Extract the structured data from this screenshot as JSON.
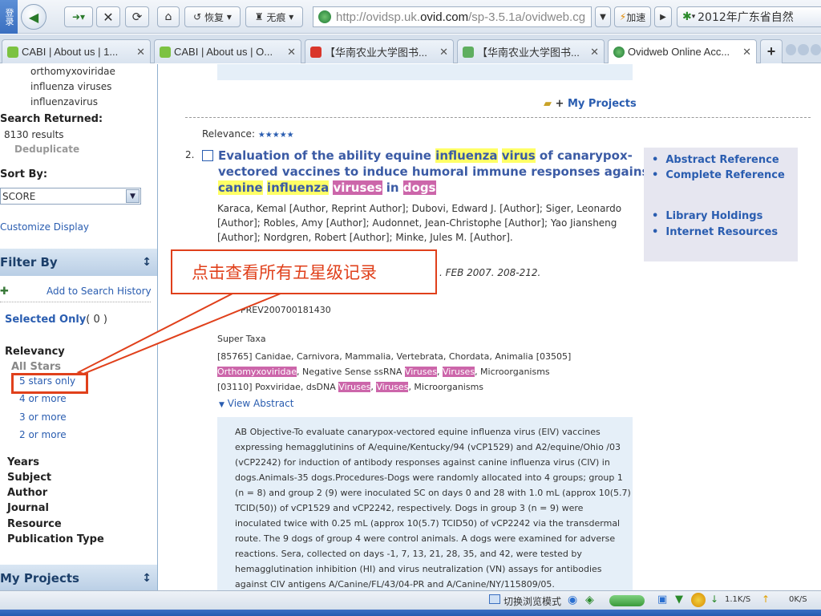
{
  "browser": {
    "side_label": "登录",
    "restore_label": "恢复",
    "notrace_label": "无痕",
    "url_prefix": "http://",
    "url_domain_pre": "ovidsp.uk.",
    "url_domain": "ovid.com",
    "url_path": "/sp-3.5.1a/ovidweb.cg",
    "accelerate_label": "加速",
    "search_text": "2012年广东省自然"
  },
  "tabs": [
    {
      "label": "CABI | About us | 1..."
    },
    {
      "label": "CABI | About us | O..."
    },
    {
      "label": "【华南农业大学图书..."
    },
    {
      "label": "【华南农业大学图书..."
    },
    {
      "label": "Ovidweb Online Acc..."
    }
  ],
  "sidebar": {
    "tree": [
      "orthomyxoviridae",
      "influenza viruses",
      "influenzavirus"
    ],
    "search_returned_label": "Search Returned:",
    "results": "8130 results",
    "deduplicate": "Deduplicate",
    "sort_by_label": "Sort By:",
    "sort_value": "SCORE",
    "customize": "Customize Display",
    "filter_by": "Filter By",
    "add_history": "Add to Search History",
    "selected_only": "Selected Only",
    "selected_count": "( 0 )",
    "relevancy_label": "Relevancy",
    "all_stars": "All Stars",
    "relevancy_options": [
      "5 stars only",
      "4 or more",
      "3 or more",
      "2 or more"
    ],
    "facets": [
      "Years",
      "Subject",
      "Author",
      "Journal",
      "Resource",
      "Publication Type"
    ],
    "my_projects": "My Projects"
  },
  "main": {
    "my_projects_link": "My Projects",
    "relevance_label": "Relevance:",
    "relevance_stars": "★★★★★",
    "record_number": "2.",
    "title": {
      "line1": [
        "Evaluation of the ability equine ",
        "influenza",
        " ",
        "virus",
        " of canarypox-"
      ],
      "line2": "vectored vaccines to induce humoral immune responses against",
      "line3": [
        "canine",
        " ",
        "influenza",
        " ",
        "viruses",
        " in ",
        "dogs"
      ]
    },
    "authors": [
      "Karaca, Kemal [Author, Reprint Author]; Dubovi, Edward J. [Author]; Siger, Leonardo",
      "[Author]; Robles, Amy [Author]; Audonnet, Jean-Christophe [Author]; Yao Jiansheng",
      "[Author]; Nordgren, Robert [Author]; Minke, Jules M. [Author]."
    ],
    "source_tail": ". FEB 2007. 208-212.",
    "accession": "PREV200700181430",
    "super_taxa_label": "Super Taxa",
    "taxa": {
      "line1": "[85765] Canidae, Carnivora, Mammalia, Vertebrata, Chordata, Animalia [03505]",
      "line2_hl1": "Orthomyxoviridae",
      "line2_mid": ", Negative Sense ssRNA ",
      "line2_hl2": "Viruses",
      "line2_sep": ", ",
      "line2_hl3": "Viruses",
      "line2_end": ", Microorganisms",
      "line3_pre": "[03110] Poxviridae, dsDNA ",
      "line3_hl1": "Viruses",
      "line3_sep": ", ",
      "line3_hl2": "Viruses",
      "line3_end": ", Microorganisms"
    },
    "view_abstract": "View Abstract",
    "abstract_lines": [
      "AB Objective-To evaluate canarypox-vectored equine influenza virus (EIV) vaccines",
      "expressing hemagglutinins of A/equine/Kentucky/94 (vCP1529) and A2/equine/Ohio /03",
      "(vCP2242) for induction of antibody responses against canine influenza virus (CIV) in",
      "dogs.Animals-35 dogs.Procedures-Dogs were randomly allocated into 4 groups; group 1",
      "(n = 8) and group 2 (9) were inoculated SC on days 0 and 28 with 1.0 mL (approx 10(5.7)",
      "TCID(50)) of vCP1529 and vCP2242, respectively. Dogs in group 3 (n = 9) were",
      "inoculated twice with 0.25 mL (approx 10(5.7) TCID50) of vCP2242 via the transdermal",
      "route. The 9 dogs of group 4 were control animals. A dogs were examined for adverse",
      "reactions. Sera, collected on days -1, 7, 13, 21, 28, 35, and 42, were tested by",
      "hemagglutination inhibition (HI) and virus neutralization (VN) assays for antibodies",
      "against CIV antigens A/Canine/FL/43/04-PR and A/Canine/NY/115809/05."
    ],
    "side_links": [
      "Abstract Reference",
      "Complete Reference",
      "Library Holdings",
      "Internet Resources"
    ]
  },
  "callout": {
    "text": "点击查看所有五星级记录"
  },
  "status": {
    "mode_label": "切换浏览模式",
    "down_speed": "1.1K/S",
    "up_speed": "0K/S"
  }
}
